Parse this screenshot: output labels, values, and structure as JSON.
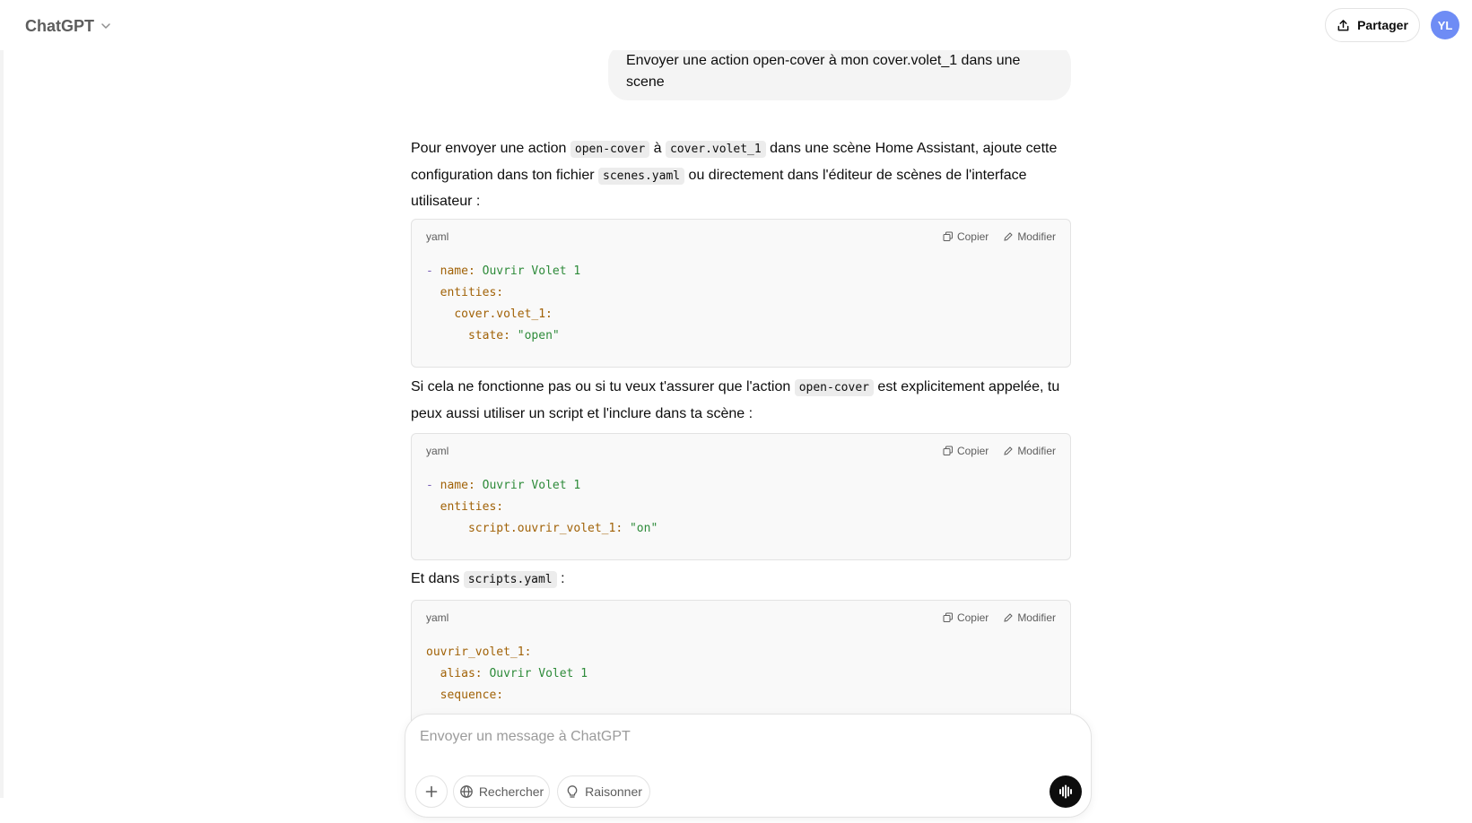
{
  "header": {
    "model_name": "ChatGPT",
    "share_label": "Partager",
    "avatar_initials": "YL"
  },
  "user_message": "Envoyer une action open-cover à mon cover.volet_1 dans une scene",
  "assistant": {
    "p1": {
      "t1": "Pour envoyer une action ",
      "c1": "open-cover",
      "t2": " à ",
      "c2": "cover.volet_1",
      "t3": " dans une scène Home Assistant, ajoute cette configuration dans ton fichier ",
      "c3": "scenes.yaml",
      "t4": " ou directement dans l'éditeur de scènes de l'interface utilisateur :"
    },
    "p2": {
      "t1": "Si cela ne fonctionne pas ou si tu veux t'assurer que l'action ",
      "c1": "open-cover",
      "t2": " est explicitement appelée, tu peux aussi utiliser un script et l'inclure dans ta scène :"
    },
    "p3": {
      "t1": "Et dans ",
      "c1": "scripts.yaml",
      "t2": " :"
    }
  },
  "code_blocks": [
    {
      "language": "yaml",
      "copy_label": "Copier",
      "edit_label": "Modifier",
      "lines": [
        [
          "- ",
          "name: ",
          "Ouvrir Volet 1"
        ],
        [
          "  ",
          "entities:",
          ""
        ],
        [
          "    ",
          "cover.volet_1:",
          ""
        ],
        [
          "      ",
          "state: ",
          "\"open\""
        ]
      ]
    },
    {
      "language": "yaml",
      "copy_label": "Copier",
      "edit_label": "Modifier",
      "lines": [
        [
          "- ",
          "name: ",
          "Ouvrir Volet 1"
        ],
        [
          "  ",
          "entities:",
          ""
        ],
        [
          "      ",
          "script.ouvrir_volet_1: ",
          "\"on\""
        ]
      ]
    },
    {
      "language": "yaml",
      "copy_label": "Copier",
      "edit_label": "Modifier",
      "lines": [
        [
          "",
          "ouvrir_volet_1:",
          ""
        ],
        [
          "  ",
          "alias: ",
          "Ouvrir Volet 1"
        ],
        [
          "  ",
          "sequence:",
          ""
        ]
      ]
    }
  ],
  "composer": {
    "placeholder": "Envoyer un message à ChatGPT",
    "search_label": "Rechercher",
    "reason_label": "Raisonner"
  },
  "icons": {
    "model_chevron": "chevron-down-icon",
    "share": "share-icon",
    "copy": "copy-icon",
    "edit": "pencil-icon",
    "plus": "plus-icon",
    "globe": "globe-icon",
    "bulb": "lightbulb-icon",
    "voice": "voice-mode-icon"
  }
}
